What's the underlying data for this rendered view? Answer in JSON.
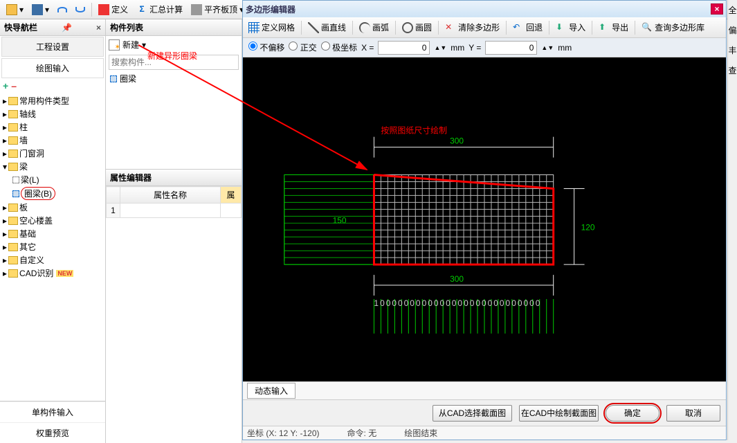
{
  "top_toolbar": {
    "define": "定义",
    "summary": "汇总计算",
    "level": "平齐板顶"
  },
  "nav": {
    "title": "快导航栏",
    "tabs": {
      "project": "工程设置",
      "draw": "绘图输入"
    },
    "plus": "+",
    "minus": "–",
    "tree": {
      "common": "常用构件类型",
      "axis": "轴线",
      "column": "柱",
      "wall": "墙",
      "openings": "门窗洞",
      "beam": "梁",
      "beam_L": "梁(L)",
      "ring_beam_B": "圈梁(B)",
      "slab": "板",
      "hollow": "空心楼盖",
      "foundation": "基础",
      "other": "其它",
      "custom": "自定义",
      "cad": "CAD识别"
    },
    "bottom": {
      "single": "单构件输入",
      "report": "权重预览"
    }
  },
  "complist": {
    "title": "构件列表",
    "new_btn": "新建",
    "red_annot": "新建异形圈梁",
    "search_placeholder": "搜索构件...",
    "item": "圈梁"
  },
  "prop": {
    "title": "属性编辑器",
    "col_name": "属性名称",
    "col_val": "属",
    "row1_idx": "1"
  },
  "editor": {
    "title": "多边形编辑器",
    "tb": {
      "grid": "定义网格",
      "line": "画直线",
      "arc": "画弧",
      "circle": "画圆",
      "clear": "清除多边形",
      "back": "回退",
      "import": "导入",
      "export": "导出",
      "query": "查询多边形库"
    },
    "coord": {
      "mode_none": "不偏移",
      "mode_ortho": "正交",
      "mode_polar": "极坐标",
      "xlbl": "X =",
      "xval": "0",
      "xunit": "mm",
      "ylbl": "Y =",
      "yval": "0",
      "yunit": "mm"
    },
    "canvas": {
      "hint": "按照图纸尺寸绘制",
      "dim_top": "300",
      "dim_left": "150",
      "dim_right": "120",
      "dim_bottom": "300",
      "ruler": "1000000000000000000000000000"
    },
    "dyn": "动态输入",
    "btns": {
      "from_cad": "从CAD选择截面图",
      "draw_in_cad": "在CAD中绘制截面图",
      "ok": "确定",
      "cancel": "取消"
    },
    "status": {
      "coords": "坐标 (X: 12 Y: -120)",
      "cmd_lbl": "命令:",
      "cmd_val": "无",
      "draw_end": "绘图结束"
    }
  },
  "rightstrip": {
    "a": "全",
    "b": "偏",
    "c": "丰",
    "d": "查"
  }
}
